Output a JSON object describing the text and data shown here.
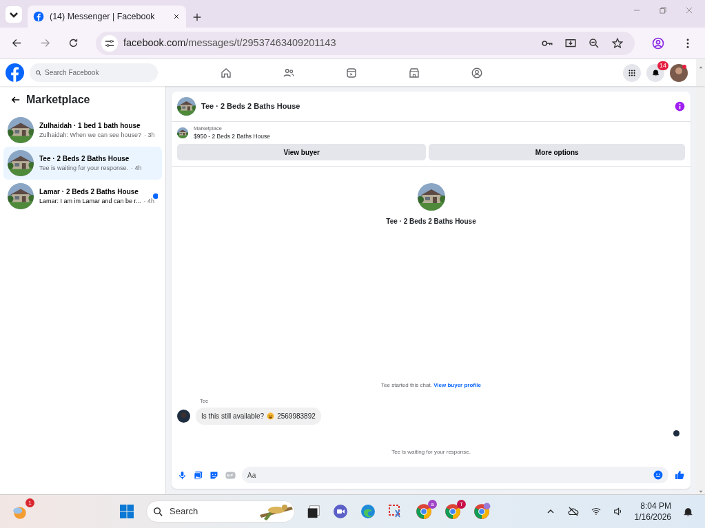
{
  "browser": {
    "tabs": [
      {
        "title": "(14) Messenger | Facebook",
        "selected": true
      }
    ],
    "url_host": "facebook.com",
    "url_path": "/messages/t/29537463409201143"
  },
  "top_nav": {
    "search_placeholder": "Search Facebook",
    "notification_count": "14"
  },
  "sidebar": {
    "title": "Marketplace",
    "conversations": [
      {
        "title": "Zulhaidah · 1 bed 1 bath house",
        "preview": "Zulhaidah: When we can see house?",
        "time": "· 3h",
        "selected": false,
        "unread": false
      },
      {
        "title": "Tee · 2 Beds 2 Baths House",
        "preview": "Tee is waiting for your response.",
        "time": "· 4h",
        "selected": true,
        "unread": false
      },
      {
        "title": "Lamar · 2 Beds 2 Baths House",
        "preview": "Lamar: I am im Lamar and can be r...",
        "time": "· 4h",
        "selected": false,
        "unread": true
      }
    ]
  },
  "chat": {
    "title": "Tee · 2 Beds 2 Baths House",
    "listing": {
      "label": "Marketplace",
      "title": "$950 - 2 Beds 2 Baths House"
    },
    "buttons": [
      "View buyer",
      "More options"
    ],
    "profile_name": "Tee · 2 Beds 2 Baths House",
    "started_note": "Tee started this chat.",
    "started_link": "View buyer profile",
    "messages": [
      {
        "sender": "Tee",
        "text_before": "Is this still available?",
        "text_after": "2569983892"
      }
    ],
    "waiting_note": "Tee is waiting for your response.",
    "composer_placeholder": "Aa"
  },
  "taskbar": {
    "weather_badge": "1",
    "search_placeholder": "Search",
    "chrome_badges": [
      "a",
      "T"
    ],
    "time": "8:04 PM",
    "date": "1/16/2026"
  }
}
